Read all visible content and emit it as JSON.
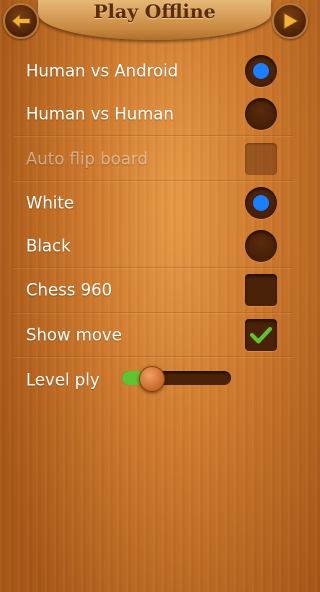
{
  "header": {
    "title": "Play Offline",
    "back_icon": "arrow-left-icon",
    "forward_icon": "arrow-right-icon"
  },
  "options": {
    "human_vs_android": {
      "label": "Human vs Android",
      "selected": true
    },
    "human_vs_human": {
      "label": "Human vs Human",
      "selected": false
    },
    "auto_flip_board": {
      "label": "Auto flip board",
      "checked": false,
      "enabled": false
    },
    "white": {
      "label": "White",
      "selected": true
    },
    "black": {
      "label": "Black",
      "selected": false
    },
    "chess_960": {
      "label": "Chess 960",
      "checked": false
    },
    "show_move": {
      "label": "Show move",
      "checked": true
    },
    "level_ply": {
      "label": "Level ply",
      "value_fraction": 0.2
    }
  },
  "colors": {
    "accent_blue": "#1a7fff",
    "check_green": "#5fc430",
    "title_brown": "#5a2c08"
  }
}
